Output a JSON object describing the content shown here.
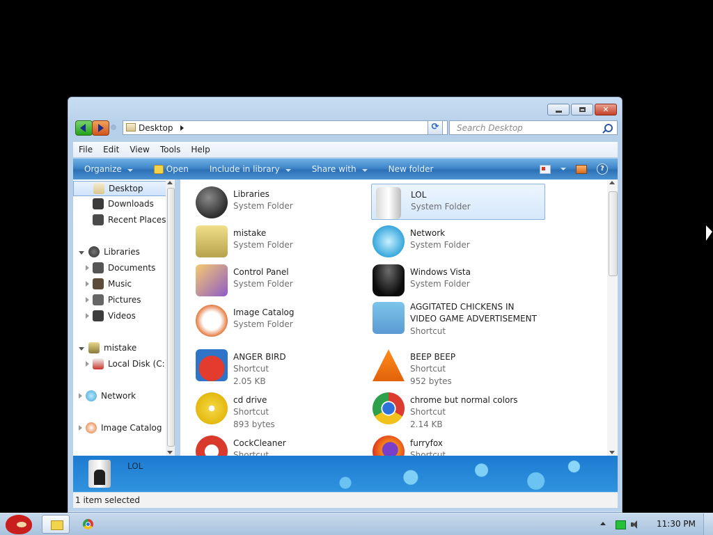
{
  "window": {
    "address": {
      "location": "Desktop"
    },
    "search": {
      "placeholder": "Search Desktop"
    },
    "menu": [
      "File",
      "Edit",
      "View",
      "Tools",
      "Help"
    ],
    "commands": {
      "organize": "Organize",
      "open": "Open",
      "include_in_library": "Include in library",
      "share_with": "Share with",
      "new_folder": "New folder"
    },
    "nav": {
      "desktop": "Desktop",
      "downloads": "Downloads",
      "recent_places": "Recent Places",
      "libraries": "Libraries",
      "documents": "Documents",
      "music": "Music",
      "pictures": "Pictures",
      "videos": "Videos",
      "mistake": "mistake",
      "local_disk": "Local Disk (C:)",
      "network": "Network",
      "image_catalog": "Image Catalog"
    },
    "items": [
      {
        "name": "Libraries",
        "type": "System Folder",
        "size": ""
      },
      {
        "name": "LOL",
        "type": "System Folder",
        "size": ""
      },
      {
        "name": "mistake",
        "type": "System Folder",
        "size": ""
      },
      {
        "name": "Network",
        "type": "System Folder",
        "size": ""
      },
      {
        "name": "Control Panel",
        "type": "System Folder",
        "size": ""
      },
      {
        "name": "Windows Vista",
        "type": "System Folder",
        "size": ""
      },
      {
        "name": "Image Catalog",
        "type": "System Folder",
        "size": ""
      },
      {
        "name": "AGGITATED CHICKENS IN VIDEO GAME ADVERTISEMENT",
        "type": "Shortcut",
        "size": ""
      },
      {
        "name": "ANGER BIRD",
        "type": "Shortcut",
        "size": "2.05 KB"
      },
      {
        "name": "BEEP BEEP",
        "type": "Shortcut",
        "size": "952 bytes"
      },
      {
        "name": "cd drive",
        "type": "Shortcut",
        "size": "893 bytes"
      },
      {
        "name": "chrome but normal colors",
        "type": "Shortcut",
        "size": "2.14 KB"
      },
      {
        "name": "CockCleaner",
        "type": "Shortcut",
        "size": ""
      },
      {
        "name": "furryfox",
        "type": "Shortcut",
        "size": ""
      }
    ],
    "selected_item": "LOL",
    "details": {
      "name": "LOL"
    },
    "status": "1 item selected"
  },
  "taskbar": {
    "clock": "11:30 PM"
  },
  "colors": {
    "accent": "#2c70b6",
    "selection": "#d6e8fb",
    "desktop": "#000000"
  },
  "icons": {
    "libraries": "meteor-rock-icon",
    "lol": "black-tower-icon",
    "mistake": "computer-icon",
    "network": "globe-icon",
    "control_panel": "control-panel-icon",
    "windows_vista": "black-cylinder-icon",
    "image_catalog": "image-catalog-icon",
    "aggitated_chickens": "angry-bird-icon",
    "anger_bird": "angry-bird-icon",
    "beep_beep": "traffic-cone-icon",
    "cd_drive": "cd-icon",
    "chrome": "chrome-icon",
    "cockcleaner": "ccleaner-icon",
    "furryfox": "firefox-icon"
  }
}
